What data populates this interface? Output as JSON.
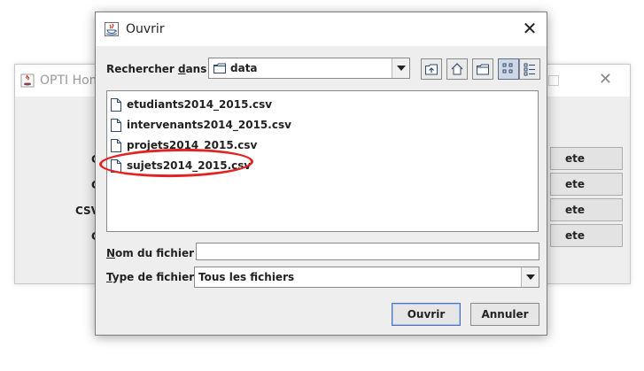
{
  "background_window": {
    "title": "OPTI Hom",
    "labels": [
      "C",
      "C",
      "CSV",
      "C"
    ],
    "buttons": [
      "ete",
      "ete",
      "ete",
      "ete"
    ]
  },
  "dialog": {
    "title": "Ouvrir",
    "look_in": {
      "label_prefix": "Rechercher ",
      "label_mnemonic": "d",
      "label_suffix": "ans :",
      "value": "data"
    },
    "files": [
      "etudiants2014_2015.csv",
      "intervenants2014_2015.csv",
      "projets2014_2015.csv",
      "sujets2014_2015.csv"
    ],
    "file_name": {
      "label_mnemonic": "N",
      "label_rest": "om du fichier :",
      "value": ""
    },
    "file_type": {
      "label_mnemonic": "T",
      "label_rest": "ype de fichier :",
      "value": "Tous les fichiers"
    },
    "open_label": "Ouvrir",
    "cancel_label": "Annuler",
    "annotation_color": "#e32222"
  }
}
